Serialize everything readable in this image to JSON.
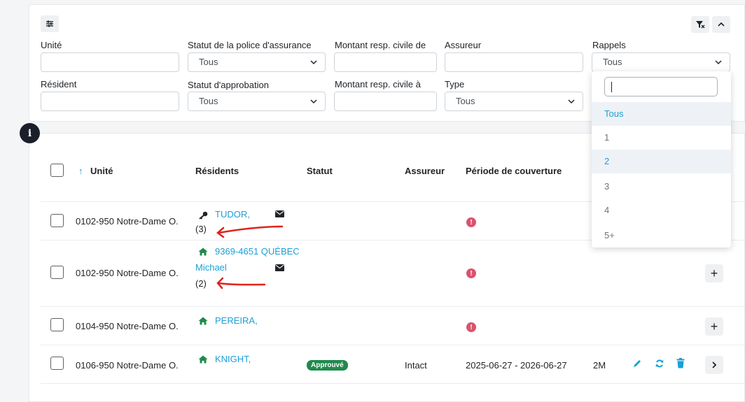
{
  "filters": {
    "unite_label": "Unité",
    "resident_label": "Résident",
    "statut_police_label": "Statut de la police d'assurance",
    "statut_police_value": "Tous",
    "statut_approbation_label": "Statut d'approbation",
    "statut_approbation_value": "Tous",
    "montant_de_label": "Montant resp. civile de",
    "montant_a_label": "Montant resp. civile à",
    "assureur_label": "Assureur",
    "type_label": "Type",
    "type_value": "Tous",
    "rappels_label": "Rappels",
    "rappels_value": "Tous"
  },
  "rappels_dropdown": {
    "search_value": "",
    "options": [
      "Tous",
      "1",
      "2",
      "3",
      "4",
      "5+"
    ],
    "selected": "Tous",
    "hovered": "2"
  },
  "table": {
    "headers": {
      "unite": "Unité",
      "sort_indicator": "↑",
      "residents": "Résidents",
      "statut": "Statut",
      "assureur": "Assureur",
      "periode": "Période de couverture"
    },
    "rows": [
      {
        "unit": "0102-950 Notre-Dame O.",
        "resident_line1": "TUDOR,",
        "resident_line2": "",
        "resident_count": "(3)",
        "statut": "",
        "assureur": "",
        "periode": "",
        "montant": ""
      },
      {
        "unit": "0102-950 Notre-Dame O.",
        "resident_line1": "9369-4651 QUÉBEC",
        "resident_line2": "Michael",
        "resident_count": "(2)",
        "statut": "",
        "assureur": "",
        "periode": "",
        "montant": ""
      },
      {
        "unit": "0104-950 Notre-Dame O.",
        "resident_line1": "PEREIRA,",
        "resident_line2": "",
        "resident_count": "",
        "statut": "",
        "assureur": "",
        "periode": "",
        "montant": ""
      },
      {
        "unit": "0106-950 Notre-Dame O.",
        "resident_line1": "KNIGHT,",
        "resident_line2": "",
        "resident_count": "",
        "statut": "Approuvé",
        "assureur": "Intact",
        "periode": "2025-06-27 - 2026-06-27",
        "montant": "2M"
      }
    ],
    "error_icon_glyph": "!",
    "plus_glyph": "+"
  },
  "info_glyph": "i",
  "colors": {
    "link": "#1a9fd6",
    "resident_home_icon": "#1f8a4c",
    "error": "#d9536f",
    "approved_badge": "#1f8a4c",
    "action_icons": "#1a9fd6",
    "annotation_arrow": "#e0241b"
  },
  "icons": [
    "sliders-icon",
    "clear-filter-icon",
    "chevron-up-icon",
    "chevron-down-icon",
    "key-icon",
    "home-icon",
    "envelope-icon",
    "edit-icon",
    "refresh-icon",
    "trash-icon",
    "chevron-right-icon",
    "info-icon",
    "sort-up-icon"
  ]
}
